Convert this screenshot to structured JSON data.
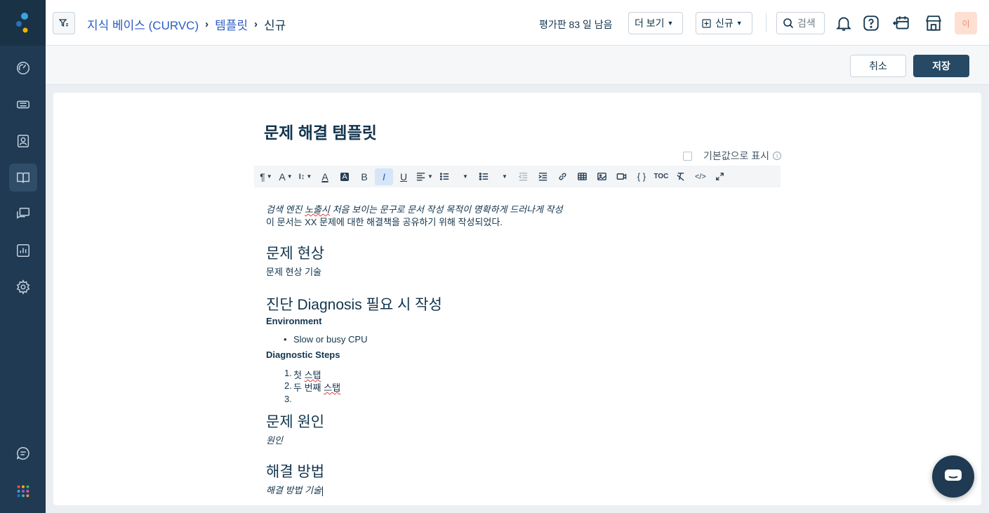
{
  "header": {
    "breadcrumb": {
      "kb": "지식 베이스 (CURVC)",
      "templates": "템플릿",
      "current": "신규",
      "separator": "›"
    },
    "trial_text": "평가판 83 일 남음",
    "more_label": "더 보기",
    "new_label": "신규",
    "search_label": "검색",
    "avatar_initial": "이"
  },
  "actions": {
    "cancel_label": "취소",
    "save_label": "저장"
  },
  "sidebar": {
    "items": [
      "dashboard-icon",
      "tickets-icon",
      "contacts-icon",
      "knowledge-base-icon",
      "conversations-icon",
      "reports-icon",
      "settings-icon"
    ],
    "bottom": [
      "chat-icon",
      "apps-icon"
    ],
    "active": "knowledge-base-icon"
  },
  "editor": {
    "title": "문제 해결 템플릿",
    "default_checkbox_label": "기본값으로 표시",
    "default_checked": false,
    "toolbar": [
      "¶",
      "A",
      "I↕",
      "A",
      "A",
      "B",
      "I",
      "U",
      "align",
      "ol",
      "ul",
      "outdent",
      "indent",
      "link",
      "table",
      "image",
      "video",
      "{ }",
      "TOC",
      "clear",
      "</>",
      "expand"
    ]
  },
  "document": {
    "intro_italic_a": "검색 엔진 ",
    "intro_italic_b": "노출시",
    "intro_italic_c": " 처음 보이는 문구로 문서 작성 목적이 명확하게 드러나게 작성",
    "intro_line": "이 문서는 XX 문제에 대한 해결책을 공유하기 위해 작성되었다.",
    "section1_heading": "문제 현상",
    "section1_text": "문제 현상 기술",
    "section2_heading": "진단 Diagnosis 필요 시 작성",
    "environment_label": "Environment",
    "environment_items": [
      "Slow or busy CPU"
    ],
    "steps_label": "Diagnostic Steps",
    "steps": [
      {
        "num": "1.",
        "a": "첫 ",
        "b": "스탭"
      },
      {
        "num": "2.",
        "a": "두 번째 ",
        "b": "스탭"
      },
      {
        "num": "3.",
        "a": "",
        "b": ""
      }
    ],
    "section3_heading": "문제 원인",
    "section3_text": "원인",
    "section4_heading": "해결 방법",
    "section4_text": "해결 방법 기술"
  },
  "colors": {
    "sidebar": "#1f3a52",
    "primary_button": "#264966",
    "link": "#2c5cc5",
    "text": "#12344d"
  }
}
